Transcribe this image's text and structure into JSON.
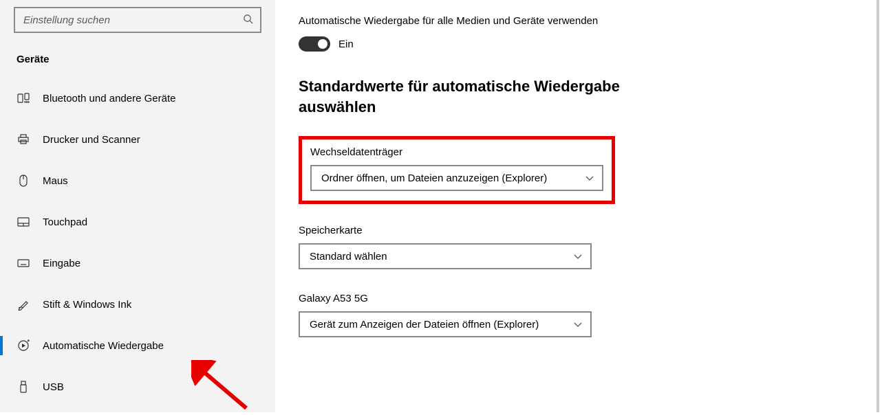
{
  "search": {
    "placeholder": "Einstellung suchen"
  },
  "sidebar": {
    "section": "Geräte",
    "items": [
      {
        "label": "Bluetooth und andere Geräte"
      },
      {
        "label": "Drucker und Scanner"
      },
      {
        "label": "Maus"
      },
      {
        "label": "Touchpad"
      },
      {
        "label": "Eingabe"
      },
      {
        "label": "Stift & Windows Ink"
      },
      {
        "label": "Automatische Wiedergabe"
      },
      {
        "label": "USB"
      }
    ]
  },
  "main": {
    "autoplay_all_label": "Automatische Wiedergabe für alle Medien und Geräte verwenden",
    "toggle_state": "Ein",
    "defaults_header": "Standardwerte für automatische Wiedergabe auswählen",
    "removable": {
      "label": "Wechseldatenträger",
      "value": "Ordner öffnen, um Dateien anzuzeigen (Explorer)"
    },
    "memorycard": {
      "label": "Speicherkarte",
      "value": "Standard wählen"
    },
    "phone": {
      "label": "Galaxy A53 5G",
      "value": "Gerät zum Anzeigen der Dateien öffnen (Explorer)"
    }
  }
}
